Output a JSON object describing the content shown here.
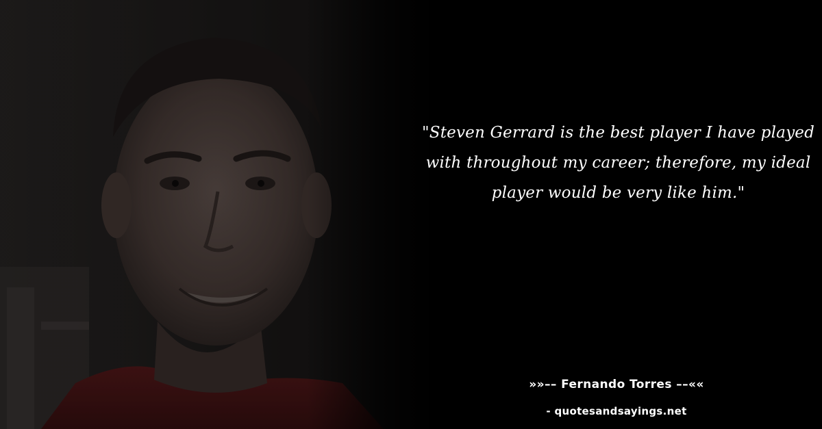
{
  "quote": {
    "text": "\"Steven Gerrard is the best player I have played with throughout my career; therefore, my ideal player would be very like him.\""
  },
  "attribution": {
    "author_line": "»»–– Fernando Torres ––««",
    "source_line": "- quotesandsayings.net"
  },
  "colors": {
    "background": "#000000",
    "text": "#ffffff",
    "shirt": "#6e1f20"
  }
}
